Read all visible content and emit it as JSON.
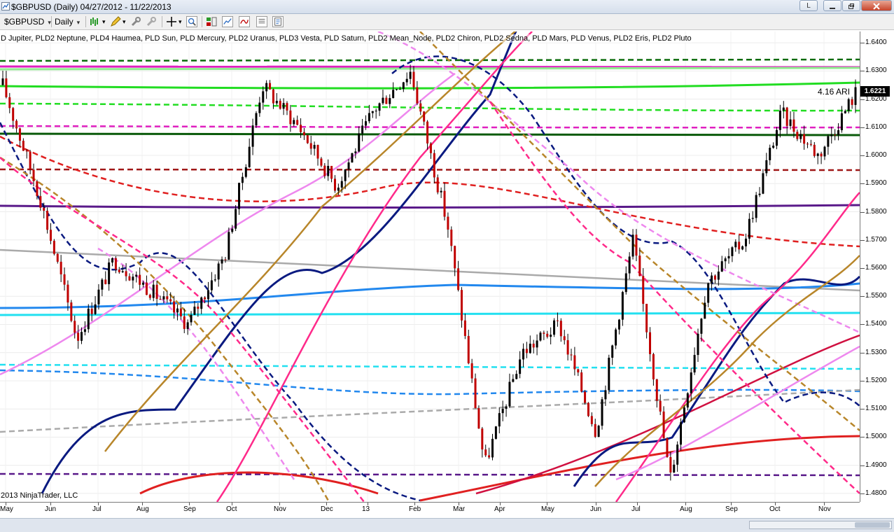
{
  "window": {
    "title": "$GBPUSD (Daily)  04/27/2012 - 11/22/2013",
    "restore_label": "L"
  },
  "toolbar": {
    "instrument": "$GBPUSD",
    "period": "Daily",
    "icons": [
      "bar-style-icon",
      "pencil-icon",
      "wrench-icon",
      "crosshair-icon",
      "zoom-icon",
      "chart-trader-icon",
      "strategies-icon",
      "properties-icon"
    ]
  },
  "legend": {
    "text": "D Jupiter, PLD2 Neptune, PLD4 Haumea, PLD Sun, PLD Mercury, PLD2 Uranus, PLD3 Vesta, PLD Saturn, PLD2 Mean_Node, PLD2 Chiron, PLD2 Sedna, PLD Mars, PLD Venus, PLD2 Eris, PLD2 Pluto"
  },
  "copyright": "2013 NinjaTrader, LLC",
  "ari_label": "4.16 ARI",
  "last_price": "1.6221",
  "colors": {
    "up_bar": "#000000",
    "down_bar": "#c00000",
    "price_tag_bg": "#000000"
  },
  "chart_data": {
    "type": "line",
    "x_labels": [
      "May",
      "Jun",
      "Jul",
      "Aug",
      "Sep",
      "Oct",
      "Nov",
      "Dec",
      "13",
      "Feb",
      "Mar",
      "Apr",
      "May",
      "Jun",
      "Jul",
      "Aug",
      "Sep",
      "Oct",
      "Nov"
    ],
    "y_ticks": [
      "1.6400",
      "1.6300",
      "1.6200",
      "1.6100",
      "1.6000",
      "1.5900",
      "1.5800",
      "1.5700",
      "1.5600",
      "1.5500",
      "1.5400",
      "1.5300",
      "1.5200",
      "1.5100",
      "1.5000",
      "1.4900",
      "1.4800"
    ],
    "ylim": [
      1.477,
      1.644
    ],
    "price_path": [
      {
        "x": "May 2012",
        "y": 1.625
      },
      {
        "x": "late May 2012",
        "y": 1.585
      },
      {
        "x": "early Jun 2012",
        "y": 1.535
      },
      {
        "x": "mid Jun 2012",
        "y": 1.563
      },
      {
        "x": "Jul 2012",
        "y": 1.552
      },
      {
        "x": "mid Jul 2012",
        "y": 1.54
      },
      {
        "x": "Aug 2012",
        "y": 1.565
      },
      {
        "x": "Sep 2012",
        "y": 1.625
      },
      {
        "x": "Oct 2012",
        "y": 1.61
      },
      {
        "x": "Nov 2012",
        "y": 1.589
      },
      {
        "x": "Dec 2012",
        "y": 1.616
      },
      {
        "x": "Jan 2013",
        "y": 1.63
      },
      {
        "x": "Feb 2013",
        "y": 1.575
      },
      {
        "x": "Mar 2013",
        "y": 1.49
      },
      {
        "x": "Apr 2013",
        "y": 1.53
      },
      {
        "x": "May 2013",
        "y": 1.54
      },
      {
        "x": "late May 2013",
        "y": 1.502
      },
      {
        "x": "Jun 2013",
        "y": 1.57
      },
      {
        "x": "Jul 2013",
        "y": 1.485
      },
      {
        "x": "Aug 2013",
        "y": 1.555
      },
      {
        "x": "Sep 2013",
        "y": 1.57
      },
      {
        "x": "Oct 2013",
        "y": 1.615
      },
      {
        "x": "Nov 2013",
        "y": 1.6
      },
      {
        "x": "22 Nov 2013",
        "y": 1.6221
      }
    ]
  }
}
